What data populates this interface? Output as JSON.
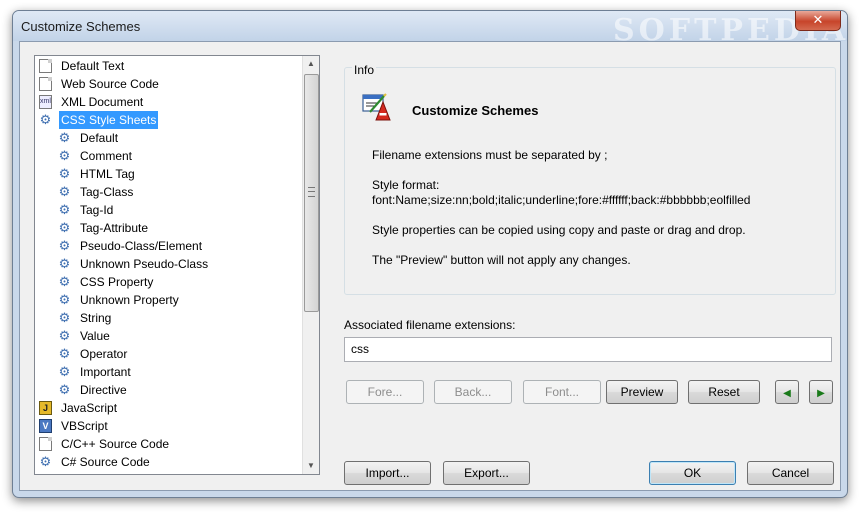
{
  "window": {
    "title": "Customize Schemes",
    "watermark": "SOFTPEDIA",
    "close_label": "✕"
  },
  "tree": {
    "items": [
      {
        "label": "Default Text",
        "icon": "document-icon",
        "indent": 0,
        "selected": false
      },
      {
        "label": "Web Source Code",
        "icon": "document-icon",
        "indent": 0,
        "selected": false
      },
      {
        "label": "XML Document",
        "icon": "xml-icon",
        "indent": 0,
        "selected": false
      },
      {
        "label": "CSS Style Sheets",
        "icon": "gear-icon",
        "indent": 0,
        "selected": true
      },
      {
        "label": "Default",
        "icon": "gear-icon",
        "indent": 1,
        "selected": false
      },
      {
        "label": "Comment",
        "icon": "gear-icon",
        "indent": 1,
        "selected": false
      },
      {
        "label": "HTML Tag",
        "icon": "gear-icon",
        "indent": 1,
        "selected": false
      },
      {
        "label": "Tag-Class",
        "icon": "gear-icon",
        "indent": 1,
        "selected": false
      },
      {
        "label": "Tag-Id",
        "icon": "gear-icon",
        "indent": 1,
        "selected": false
      },
      {
        "label": "Tag-Attribute",
        "icon": "gear-icon",
        "indent": 1,
        "selected": false
      },
      {
        "label": "Pseudo-Class/Element",
        "icon": "gear-icon",
        "indent": 1,
        "selected": false
      },
      {
        "label": "Unknown Pseudo-Class",
        "icon": "gear-icon",
        "indent": 1,
        "selected": false
      },
      {
        "label": "CSS Property",
        "icon": "gear-icon",
        "indent": 1,
        "selected": false
      },
      {
        "label": "Unknown Property",
        "icon": "gear-icon",
        "indent": 1,
        "selected": false
      },
      {
        "label": "String",
        "icon": "gear-icon",
        "indent": 1,
        "selected": false
      },
      {
        "label": "Value",
        "icon": "gear-icon",
        "indent": 1,
        "selected": false
      },
      {
        "label": "Operator",
        "icon": "gear-icon",
        "indent": 1,
        "selected": false
      },
      {
        "label": "Important",
        "icon": "gear-icon",
        "indent": 1,
        "selected": false
      },
      {
        "label": "Directive",
        "icon": "gear-icon",
        "indent": 1,
        "selected": false
      },
      {
        "label": "JavaScript",
        "icon": "javascript-icon",
        "indent": 0,
        "selected": false
      },
      {
        "label": "VBScript",
        "icon": "vbscript-icon",
        "indent": 0,
        "selected": false
      },
      {
        "label": "C/C++ Source Code",
        "icon": "document-icon",
        "indent": 0,
        "selected": false
      },
      {
        "label": "C# Source Code",
        "icon": "gear-icon",
        "indent": 0,
        "selected": false
      }
    ]
  },
  "info": {
    "group_label": "Info",
    "title": "Customize Schemes",
    "lines": [
      "Filename extensions must be separated by ;",
      "Style format:",
      "font:Name;size:nn;bold;italic;underline;fore:#ffffff;back:#bbbbbb;eolfilled",
      "Style properties can be copied using copy and paste or drag and drop.",
      "The \"Preview\" button will not apply any changes."
    ]
  },
  "extensions": {
    "label": "Associated filename extensions:",
    "value": "css"
  },
  "buttons": {
    "fore": "Fore...",
    "back": "Back...",
    "font": "Font...",
    "preview": "Preview",
    "reset": "Reset",
    "import": "Import...",
    "export": "Export...",
    "ok": "OK",
    "cancel": "Cancel"
  },
  "colors": {
    "selection": "#3399ff",
    "nav_arrow": "#1a7a1a"
  }
}
